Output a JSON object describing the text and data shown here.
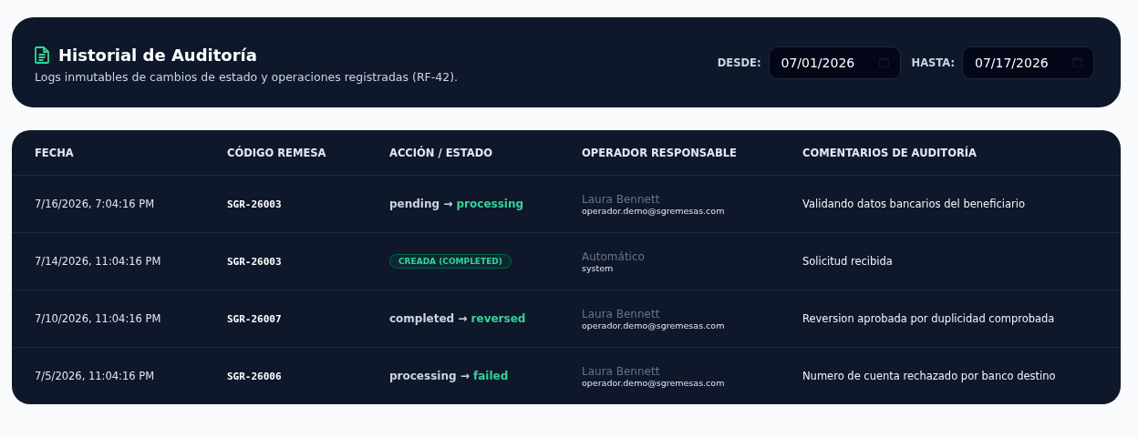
{
  "header": {
    "title": "Historial de Auditoría",
    "subtitle": "Logs inmutables de cambios de estado y operaciones registradas (RF-42).",
    "filters": [
      {
        "label": "DESDE:",
        "value": "07/01/2026"
      },
      {
        "label": "HASTA:",
        "value": "07/17/2026"
      }
    ]
  },
  "table": {
    "columns": [
      "FECHA",
      "CÓDIGO REMESA",
      "ACCIÓN / ESTADO",
      "OPERADOR RESPONSABLE",
      "COMENTARIOS DE AUDITORÍA"
    ],
    "rows": [
      {
        "date": "7/16/2026, 7:04:16 PM",
        "code": "SGR-26003",
        "action": {
          "kind": "transition",
          "from": "pending",
          "arrow": "→",
          "to": "processing"
        },
        "operator_name": "Laura Bennett",
        "operator_email": "operador.demo@sgremesas.com",
        "comment": "Validando datos bancarios del beneficiario"
      },
      {
        "date": "7/14/2026, 11:04:16 PM",
        "code": "SGR-26003",
        "action": {
          "kind": "badge",
          "label": "CREADA (COMPLETED)"
        },
        "operator_name": "Automático",
        "operator_email": "system",
        "comment": "Solicitud recibida"
      },
      {
        "date": "7/10/2026, 11:04:16 PM",
        "code": "SGR-26007",
        "action": {
          "kind": "transition",
          "from": "completed",
          "arrow": "→",
          "to": "reversed"
        },
        "operator_name": "Laura Bennett",
        "operator_email": "operador.demo@sgremesas.com",
        "comment": "Reversion aprobada por duplicidad comprobada"
      },
      {
        "date": "7/5/2026, 11:04:16 PM",
        "code": "SGR-26006",
        "action": {
          "kind": "transition",
          "from": "processing",
          "arrow": "→",
          "to": "failed"
        },
        "operator_name": "Laura Bennett",
        "operator_email": "operador.demo@sgremesas.com",
        "comment": "Numero de cuenta rechazado por banco destino"
      }
    ]
  }
}
